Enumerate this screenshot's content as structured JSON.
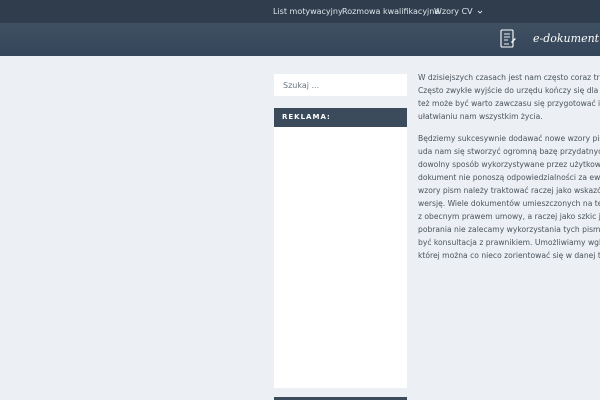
{
  "nav": {
    "items": [
      {
        "label": "List motywacyjny"
      },
      {
        "label": "Rozmowa kwalifikacyjna"
      },
      {
        "label": "Wzory CV"
      }
    ]
  },
  "header": {
    "logo_icon": "document-icon",
    "logo_text": "e-dokument"
  },
  "sidebar": {
    "search_placeholder": "Szukaj ...",
    "widget_title": "REKLAMA:"
  },
  "content": {
    "paragraph1_lines": [
      "W dzisiejszych czasach jest nam często coraz trudn",
      "Często zwykłe wyjście do urzędu kończy się dla wielu i",
      "też może być warto zawczasu się przygotować i zac",
      "ułatwianiu nam wszystkim życia."
    ],
    "paragraph2_lines": [
      "Będziemy sukcesywnie dodawać nowe wzory pism ta",
      "uda nam się stworzyć ogromną bazę przydatnych p",
      "dowolny sposób wykorzystywane przez użytkownikó",
      "dokument nie ponoszą odpowiedzialności za ewentua",
      "wzory pism należy traktować raczej jako wskazówkę",
      "z obecnym prawem umowy, a raczej jako szkic jedne",
      "pobrania nie zalecamy wykorzystania tych pism jako o",
      "być konsultacja z prawnikiem. Umożliwiamy wgląd w w",
      "której można co nieco zorientować się w danej tematyc"
    ],
    "paragraph2_extra": [
      "wersję. Wiele dokumentów umieszczonych na tej stro"
    ]
  }
}
